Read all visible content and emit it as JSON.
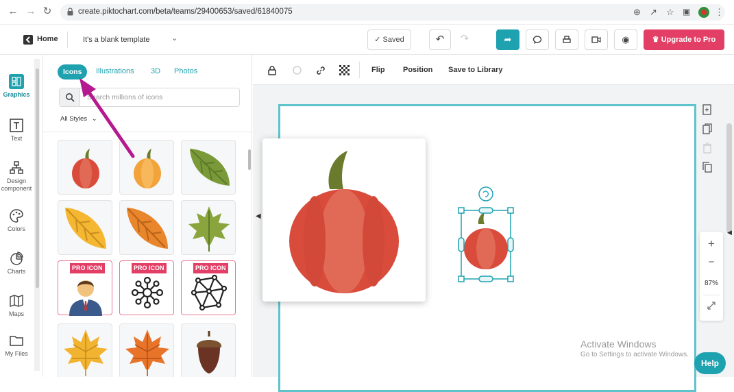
{
  "browser": {
    "url": "create.piktochart.com/beta/teams/29400653/saved/61840075"
  },
  "toolbar": {
    "home_label": "Home",
    "template_name": "It's a blank template",
    "saved_label": "✓ Saved",
    "upgrade_label": "Upgrade to Pro",
    "accent_color": "#1ea2b0",
    "upgrade_color": "#e33f66"
  },
  "rail": {
    "items": [
      {
        "label": "Graphics",
        "icon": "graphics-icon"
      },
      {
        "label": "Text",
        "icon": "text-icon"
      },
      {
        "label": "Design component",
        "icon": "design-component-icon"
      },
      {
        "label": "Colors",
        "icon": "palette-icon"
      },
      {
        "label": "Charts",
        "icon": "chart-icon"
      },
      {
        "label": "Maps",
        "icon": "map-icon"
      },
      {
        "label": "My Files",
        "icon": "folder-icon"
      }
    ]
  },
  "panel": {
    "tabs": [
      "Icons",
      "Illustrations",
      "3D",
      "Photos"
    ],
    "search_placeholder": "Search millions of icons",
    "styles_label": "All Styles",
    "pro_tag": "PRO ICON",
    "tiles": [
      {
        "icon": "red-pumpkin-icon",
        "pro": false
      },
      {
        "icon": "orange-pumpkin-icon",
        "pro": false
      },
      {
        "icon": "green-leaf-icon",
        "pro": false
      },
      {
        "icon": "yellow-leaf-icon",
        "pro": false
      },
      {
        "icon": "orange-leaf-icon",
        "pro": false
      },
      {
        "icon": "green-maple-leaf-icon",
        "pro": false
      },
      {
        "icon": "businessman-icon",
        "pro": true
      },
      {
        "icon": "molecule-network-icon",
        "pro": true
      },
      {
        "icon": "polygon-network-icon",
        "pro": true
      },
      {
        "icon": "yellow-maple-leaf-icon",
        "pro": false
      },
      {
        "icon": "orange-maple-leaf-icon",
        "pro": false
      },
      {
        "icon": "acorn-icon",
        "pro": false
      }
    ]
  },
  "context_toolbar": {
    "flip_label": "Flip",
    "position_label": "Position",
    "save_library_label": "Save to Library"
  },
  "zoom": {
    "level": "87%",
    "plus": "+",
    "minus": "−"
  },
  "watermark": {
    "title": "Activate Windows",
    "subtitle": "Go to Settings to activate Windows."
  },
  "help_label": "Help"
}
